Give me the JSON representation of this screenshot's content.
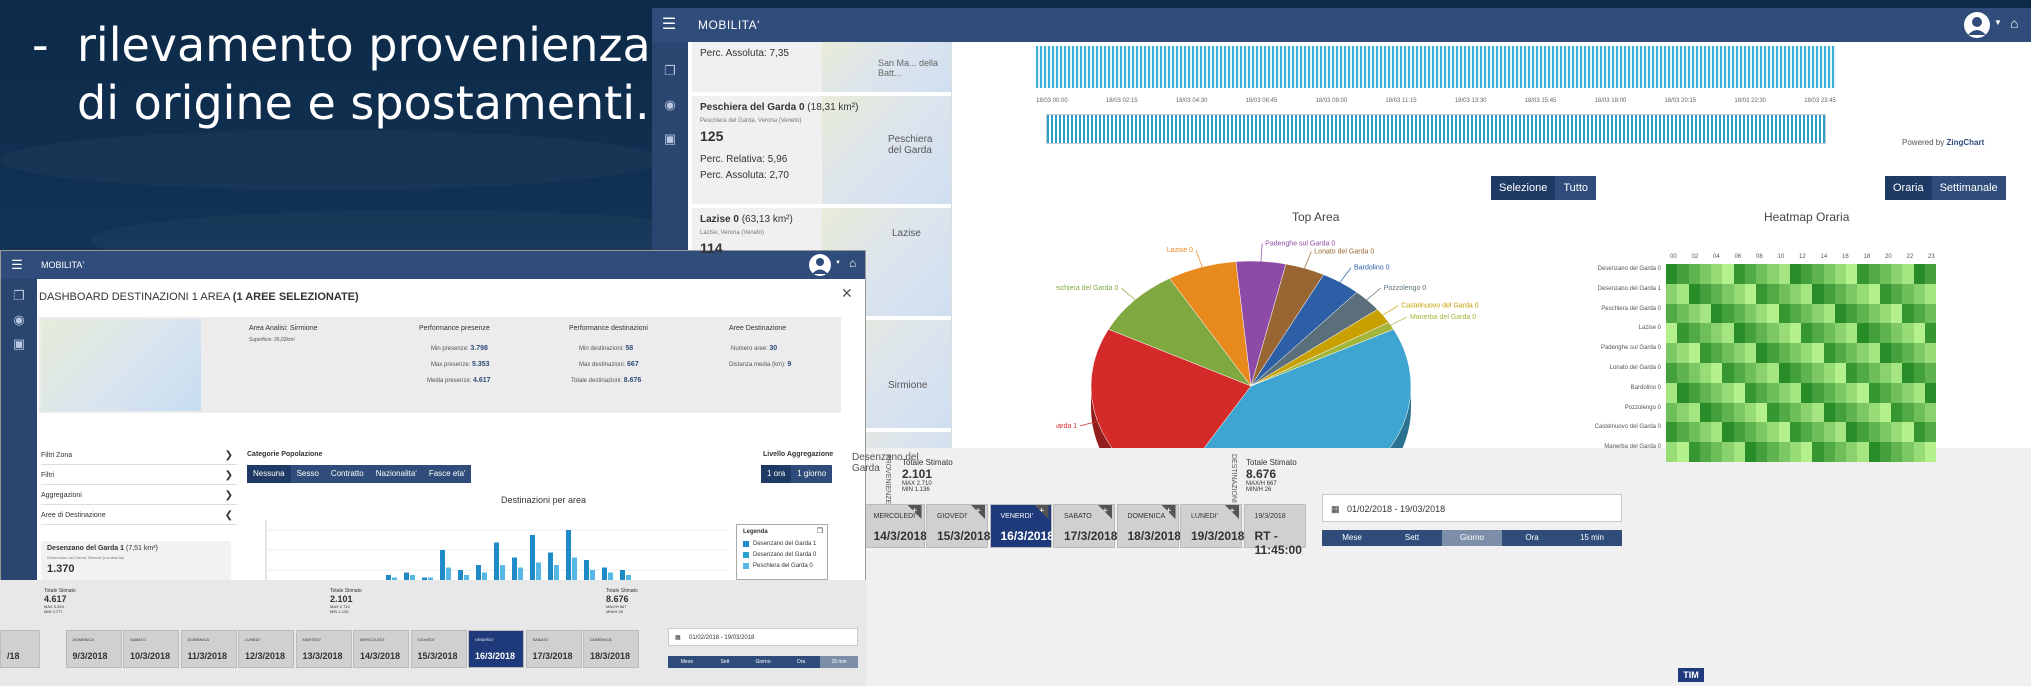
{
  "slide": {
    "bullet": "-",
    "line1": "rilevamento provenienza",
    "line2": "di origine e spostamenti."
  },
  "back": {
    "app_title": "MOBILITA'",
    "cards": [
      {
        "pct_abs": "Perc. Assoluta: 7,35",
        "map_text": "San Ma... della Batt..."
      },
      {
        "name": "Peschiera del Garda 0",
        "area": "(18,31 km²)",
        "region": "Peschiera del Garda, Verona (Veneto)",
        "count": "125",
        "pct_rel": "Perc. Relativa: 5,96",
        "pct_abs": "Perc. Assoluta: 2,70",
        "map_text": "Peschiera del Garda"
      },
      {
        "name": "Lazise 0",
        "area": "(63,13 km²)",
        "region": "Lazise, Verona (Veneto)",
        "count": "114",
        "map_text": "Lazise"
      },
      {
        "map_text": "Sirmione"
      },
      {
        "map_text": "Desenzano del Garda"
      }
    ],
    "timeline_ticks": [
      "18/03 00:00",
      "18/03 02:15",
      "18/03 04:30",
      "18/03 06:45",
      "18/03 09:00",
      "18/03 11:15",
      "18/03 13:30",
      "18/03 15:45",
      "18/03 18:00",
      "18/03 20:15",
      "18/03 22:30",
      "18/03 23:45"
    ],
    "powered_by": "Powered by",
    "zingchart": "ZingChart",
    "selezione": "Selezione",
    "tutto": "Tutto",
    "oraria": "Oraria",
    "settimanale": "Settimanale",
    "top_area_title": "Top Area",
    "heatmap_title": "Heatmap Oraria",
    "heat_rows": [
      "Desenzano del Garda 0",
      "Desenzano del Garda 1",
      "Peschiera del Garda 0",
      "Lazise 0",
      "Padenghe sul Garda 0",
      "Lonato del Garda 0",
      "Bardolino 0",
      "Pozzolengo 0",
      "Castelnuovo del Garda 0",
      "Manerba del Garda 0"
    ],
    "heat_cols": [
      "00",
      "02",
      "04",
      "06",
      "08",
      "10",
      "12",
      "14",
      "16",
      "18",
      "20",
      "22",
      "23"
    ],
    "footer": {
      "prov_label": "PROVENIENZE",
      "dest_label": "DESTINAZIONI",
      "stat1": {
        "label": "Totale Stimato",
        "value": "2.101",
        "max": "MAX 2.710",
        "min": "MIN 1.136"
      },
      "stat2": {
        "label": "Totale Stimato",
        "value": "8.676",
        "max": "MAX/H 667",
        "min": "MIN/H 26"
      },
      "days": [
        {
          "name": "DOMENICA",
          "date": "11/3/2018"
        },
        {
          "name": "LUNEDI'",
          "date": "12/3/2018"
        },
        {
          "name": "MARTEDI'",
          "date": "13/3/2018"
        },
        {
          "name": "MERCOLEDI'",
          "date": "14/3/2018"
        },
        {
          "name": "GIOVEDI'",
          "date": "15/3/2018"
        },
        {
          "name": "VENERDI'",
          "date": "16/3/2018"
        },
        {
          "name": "SABATO",
          "date": "17/3/2018"
        },
        {
          "name": "DOMENICA",
          "date": "18/3/2018"
        },
        {
          "name": "LUNEDI'",
          "date": "19/3/2018"
        },
        {
          "name": "19/3/2018",
          "date": "RT - 11:45:00"
        }
      ],
      "date_range": "01/02/2018 - 19/03/2018",
      "periods": [
        "Mese",
        "Sett",
        "Giorno",
        "Ora",
        "15 min"
      ]
    }
  },
  "front": {
    "app_title": "MOBILITA'",
    "dash_title": "DASHBOARD DESTINAZIONI 1 AREA",
    "dash_sub": "(1 AREE SELEZIONATE)",
    "summary": {
      "area_head": "Area Analisi: Sirmione",
      "area_sup": "Superficie: 26,02km²",
      "perf_pres": "Performance presenze",
      "perf_dest": "Performance destinazioni",
      "aree_dest": "Aree Destinazione",
      "min_pres_l": "Min presenze:",
      "min_pres_v": "3.798",
      "max_pres_l": "Max presenze:",
      "max_pres_v": "5.353",
      "avg_pres_l": "Media presenze:",
      "avg_pres_v": "4.617",
      "min_dest_l": "Min destinazioni:",
      "min_dest_v": "58",
      "max_dest_l": "Max destinazioni:",
      "max_dest_v": "667",
      "tot_dest_l": "Totale destinazioni:",
      "tot_dest_v": "8.676",
      "num_aree_l": "Numero aree:",
      "num_aree_v": "30",
      "dist_l": "Distanza media (km):",
      "dist_v": "9"
    },
    "filters": [
      "Filtri Zona",
      "Filtri",
      "Aggregazioni",
      "Aree di Destinazione"
    ],
    "cat_title": "Categorie Popolazione",
    "cats": [
      "Nessuna",
      "Sesso",
      "Contratto",
      "Nazionalita'",
      "Fasce eta'"
    ],
    "agg_title": "Livello Aggregazione",
    "aggs": [
      "1 ora",
      "1 giorno"
    ],
    "chart_title": "Destinazioni per area",
    "legend_title": "Legenda",
    "legend": [
      "Desenzano del Garda 1",
      "Desenzano del Garda 0",
      "Peschiera del Garda 0"
    ],
    "card": {
      "name": "Desenzano del Garda 1",
      "area": "(7,51 km²)",
      "region": "Desenzano del Garda, Brescia (Lombardia)",
      "count": "1.370"
    },
    "footer": {
      "stat1": {
        "label": "Totale Stimato",
        "value": "4.617",
        "max": "MAX 5.353",
        "min": "MIN 3.777"
      },
      "stat2": {
        "label": "Totale Stimato",
        "value": "2.101",
        "max": "MAX 2.710",
        "min": "MIN 1.136"
      },
      "stat3": {
        "label": "Totale Stimato",
        "value": "8.676",
        "max": "MAX/H 667",
        "min": "MIN/H 26"
      },
      "days": [
        {
          "name": "",
          "date": "/18"
        },
        {
          "name": "DOMENICA",
          "date": "9/3/2018"
        },
        {
          "name": "SABATO",
          "date": "10/3/2018"
        },
        {
          "name": "DOMENICA",
          "date": "11/3/2018"
        },
        {
          "name": "LUNEDI'",
          "date": "12/3/2018"
        },
        {
          "name": "MARTEDI'",
          "date": "13/3/2018"
        },
        {
          "name": "MERCOLEDI'",
          "date": "14/3/2018"
        },
        {
          "name": "GIOVEDI'",
          "date": "15/3/2018"
        },
        {
          "name": "VENERDI'",
          "date": "16/3/2018"
        },
        {
          "name": "SABATO",
          "date": "17/3/2018"
        },
        {
          "name": "DOMENICA",
          "date": "18/3/2018"
        }
      ],
      "date_range": "01/02/2018 - 19/03/2018",
      "periods": [
        "Mese",
        "Sett",
        "Giorno",
        "Ora",
        "15 min"
      ]
    }
  },
  "tim_logo": "TIM",
  "chart_data": [
    {
      "type": "pie",
      "title": "Top Area",
      "categories": [
        "Desenzano del Garda 0",
        "Desenzano del Garda 1",
        "Peschiera del Garda 0",
        "Lazise 0",
        "Padenghe sul Garda 0",
        "Lonato del Garda 0",
        "Bardolino 0",
        "Pozzolengo 0",
        "Castelnuovo del Garda 0",
        "Manerba del Garda 0"
      ],
      "values": [
        41,
        24,
        9,
        7,
        5,
        4,
        4,
        3,
        2,
        1
      ],
      "colors": [
        "#3ea4d0",
        "#d42a2a",
        "#80a840",
        "#e8891e",
        "#8d4aa6",
        "#996633",
        "#2d5fa6",
        "#5a6f7a",
        "#c8a000",
        "#a3b53a"
      ]
    },
    {
      "type": "bar",
      "title": "Destinazioni per area",
      "series": [
        {
          "name": "Desenzano del Garda 1",
          "values": [
            2,
            3,
            1,
            12,
            4,
            6,
            15,
            9,
            18,
            11,
            20,
            8,
            5,
            4
          ]
        },
        {
          "name": "Desenzano del Garda 0",
          "values": [
            1,
            2,
            1,
            5,
            2,
            3,
            6,
            5,
            7,
            6,
            9,
            4,
            3,
            2
          ]
        }
      ],
      "colors": [
        "#1f8ac8",
        "#55b8e6"
      ]
    }
  ]
}
